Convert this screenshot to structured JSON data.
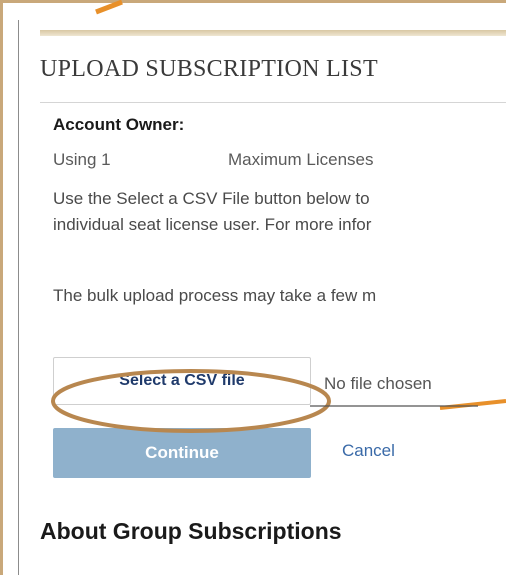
{
  "page": {
    "title": "UPLOAD SUBSCRIPTION LIST"
  },
  "account": {
    "owner_label": "Account Owner:",
    "using_text": "Using 1",
    "max_text": "Maximum Licenses"
  },
  "instructions": {
    "line1": "Use the Select a CSV File button below to",
    "line2": "individual seat license user. For more infor",
    "bulk_note": "The bulk upload process may take a few m"
  },
  "file_upload": {
    "button_label": "Select a CSV file",
    "status": "No file chosen"
  },
  "actions": {
    "continue_label": "Continue",
    "cancel_label": "Cancel"
  },
  "section": {
    "about_heading": "About Group Subscriptions"
  },
  "colors": {
    "annotation": "#b8874f",
    "continue_bg": "#8fb1cc",
    "link": "#3a6aa8"
  }
}
